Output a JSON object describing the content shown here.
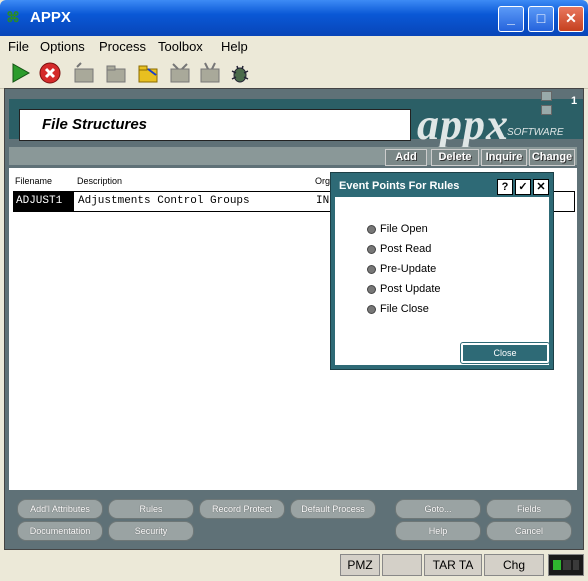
{
  "window": {
    "title": "APPX"
  },
  "menu": [
    "File",
    "Options",
    "Process",
    "Toolbox",
    "Help"
  ],
  "banner": {
    "title": "File Structures",
    "logo": "appx",
    "logo_sub": "SOFTWARE",
    "page": "1"
  },
  "actions": [
    "Add",
    "Delete",
    "Inquire",
    "Change"
  ],
  "table": {
    "headers": [
      "Filename",
      "Description",
      "Org"
    ],
    "rows": [
      {
        "filename": "ADJUST1",
        "description": "Adjustments Control Groups",
        "org": "IN"
      }
    ]
  },
  "bottom_buttons": {
    "row1": [
      "Add'l Attributes",
      "Rules",
      "Record Protect",
      "Default Process",
      "Goto...",
      "Fields"
    ],
    "row2": [
      "Documentation",
      "Security",
      "Help",
      "Cancel"
    ]
  },
  "status": [
    "PMZ",
    "",
    "TAR TA",
    "Chg"
  ],
  "dialog": {
    "title": "Event Points For Rules",
    "options": [
      "File Open",
      "Post Read",
      "Pre-Update",
      "Post Update",
      "File Close"
    ],
    "close_label": "Close"
  }
}
